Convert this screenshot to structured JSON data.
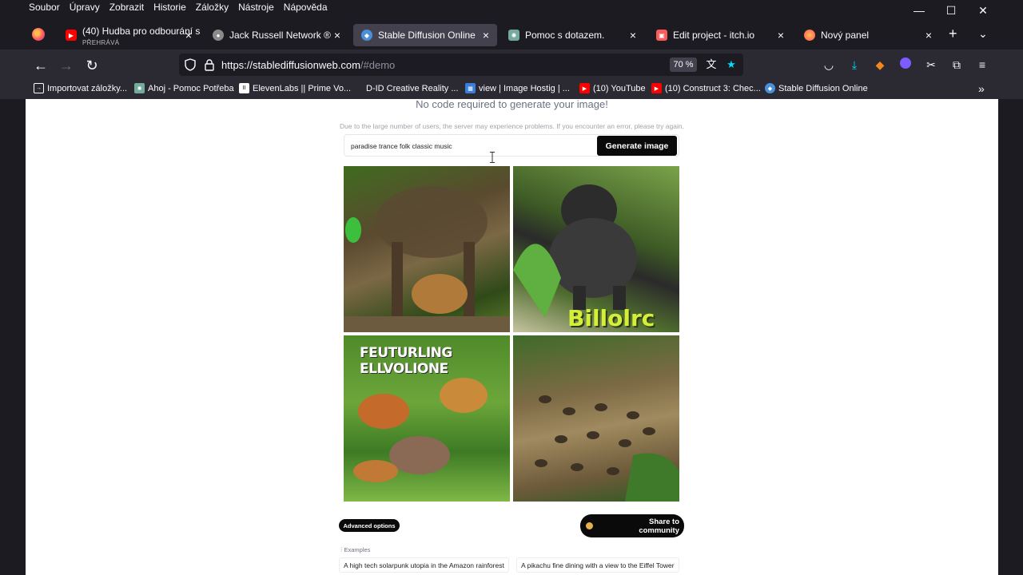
{
  "menu": [
    "Soubor",
    "Úpravy",
    "Zobrazit",
    "Historie",
    "Záložky",
    "Nástroje",
    "Nápověda"
  ],
  "window_controls": {
    "minimize": "—",
    "maximize": "☐",
    "close": "✕"
  },
  "tabs": [
    {
      "label": "(40) Hudba pro odbourání st",
      "sub": "PŘEHRÁVÁ",
      "icon": "youtube-icon",
      "color": "#ff0000"
    },
    {
      "label": "Jack Russell Network ®",
      "icon": "globe-icon",
      "color": "#8a8a8a"
    },
    {
      "label": "Stable Diffusion Online",
      "icon": "stable-diffusion-icon",
      "color": "#4a90d9",
      "active": true
    },
    {
      "label": "Pomoc s dotazem.",
      "icon": "chatgpt-icon",
      "color": "#74aa9c"
    },
    {
      "label": "Edit project - itch.io",
      "icon": "itchio-icon",
      "color": "#fa5c5c"
    },
    {
      "label": "Nový panel",
      "icon": "firefox-icon",
      "color": "#ff7139"
    }
  ],
  "nav": {
    "url_main": "https://stablediffusionweb.com",
    "url_hash": "/#demo",
    "zoom": "70 %"
  },
  "bookmarks": [
    {
      "label": "Importovat záložky...",
      "icon": "import-icon",
      "color": "#2b2a33"
    },
    {
      "label": "Ahoj - Pomoc Potřeba",
      "icon": "chatgpt-icon",
      "color": "#74aa9c"
    },
    {
      "label": "ElevenLabs || Prime Vo...",
      "icon": "elevenlabs-icon",
      "color": "#ffffff"
    },
    {
      "label": "D-ID Creative Reality ...",
      "icon": "did-icon",
      "color": "#2b2a33"
    },
    {
      "label": "view | Image Hostig | ...",
      "icon": "image-host-icon",
      "color": "#3b7dd8"
    },
    {
      "label": "(10) YouTube",
      "icon": "youtube-icon",
      "color": "#ff0000"
    },
    {
      "label": "(10) Construct 3: Chec...",
      "icon": "youtube-icon",
      "color": "#ff0000"
    },
    {
      "label": "Stable Diffusion Online",
      "icon": "stable-diffusion-icon",
      "color": "#4a90d9"
    }
  ],
  "page": {
    "headline": "No code required to generate your image!",
    "notice": "Due to the large number of users, the server may experience problems. If you encounter an error, please try again.",
    "prompt_value": "paradise trance folk classic music",
    "generate_label": "Generate image",
    "image_text_1": "FEUTURLING ELLVOLIONE",
    "image_text_2": "Billolrc",
    "advanced_label": "Advanced options",
    "share_label": "Share to community",
    "examples_label": "Examples",
    "examples": [
      "A high tech solarpunk utopia in the Amazon rainforest",
      "A pikachu fine dining with a view to the Eiffel Tower"
    ]
  }
}
